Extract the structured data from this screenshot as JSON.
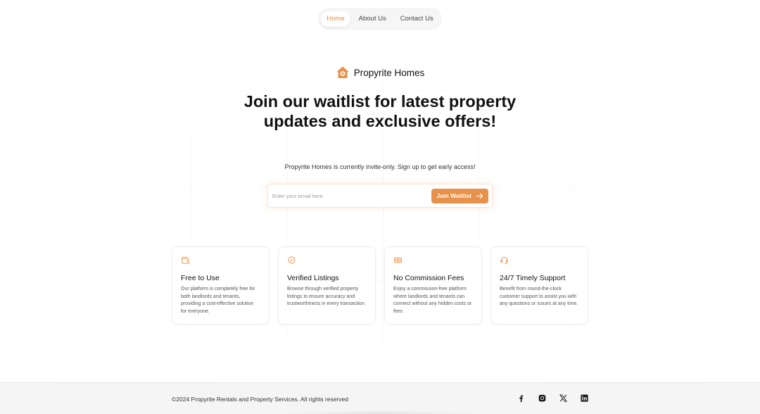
{
  "nav": {
    "items": [
      {
        "label": "Home",
        "active": true
      },
      {
        "label": "About Us",
        "active": false
      },
      {
        "label": "Contact Us",
        "active": false
      }
    ]
  },
  "brand": {
    "name": "Propyrite Homes",
    "logo_icon": "house-logo-icon"
  },
  "hero": {
    "title": "Join our waitlist for latest property updates and exclusive offers!",
    "subtitle": "Propyrite Homes is currently invite-only. Sign up to get early access!"
  },
  "form": {
    "email_placeholder": "Enter your email here",
    "email_value": "",
    "button_label": "Join Waitlist",
    "button_icon": "arrow-right-icon"
  },
  "features": [
    {
      "icon": "wallet-icon",
      "title": "Free to Use",
      "description": "Our platform is completely free for both landlords and tenants, providing a cost-effective solution for everyone."
    },
    {
      "icon": "check-circle-icon",
      "title": "Verified Listings",
      "description": "Browse through verified property listings to ensure accuracy and trustworthiness in every transaction."
    },
    {
      "icon": "cash-icon",
      "title": "No Commission Fees",
      "description": "Enjoy a commission-free platform where landlords and tenants can connect without any hidden costs or fees"
    },
    {
      "icon": "headset-icon",
      "title": "24/7 Timely Support",
      "description": "Benefit from round-the-clock customer support to assist you with any questions or issues at any time."
    }
  ],
  "footer": {
    "copyright": "©2024 Propyrite Rentals and Property Services. All rights reserved",
    "socials": [
      "facebook-icon",
      "instagram-icon",
      "x-icon",
      "linkedin-icon"
    ]
  },
  "colors": {
    "accent": "#e8914a",
    "text": "#111111",
    "footer_bg": "#f5f5f6"
  }
}
